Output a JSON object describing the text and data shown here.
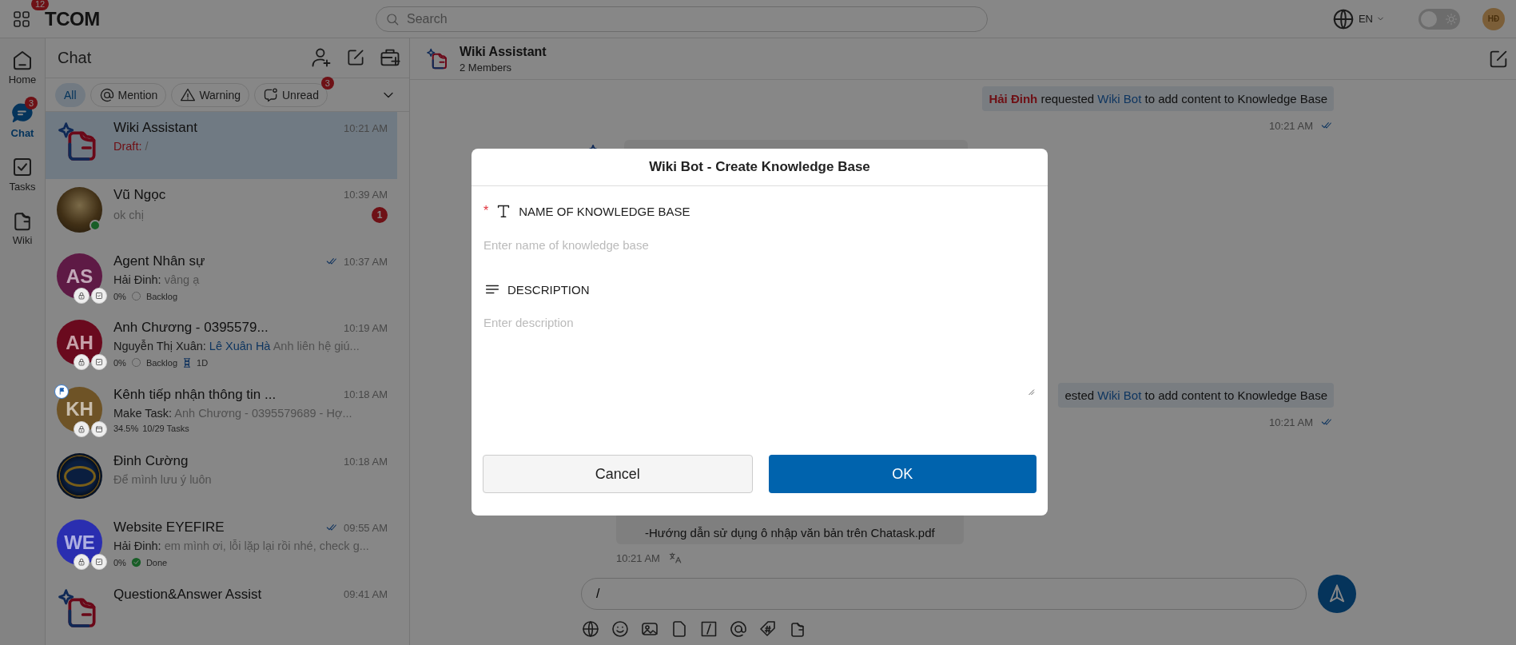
{
  "app": {
    "name": "TCOM",
    "apps_badge": "12"
  },
  "search": {
    "placeholder": "Search"
  },
  "language": {
    "label": "EN"
  },
  "theme_toggle": {
    "on": false
  },
  "user": {
    "initials": "HĐ"
  },
  "nav": [
    {
      "label": "Home",
      "kind": "home",
      "selected": false
    },
    {
      "label": "Chat",
      "kind": "chat",
      "selected": true,
      "badge": "3"
    },
    {
      "label": "Tasks",
      "kind": "tasks",
      "selected": false
    },
    {
      "label": "Wiki",
      "kind": "wiki",
      "selected": false
    }
  ],
  "chat_list": {
    "title": "Chat",
    "filters": [
      {
        "label": "All",
        "kind": "all",
        "selected": true
      },
      {
        "label": "Mention",
        "kind": "mention",
        "selected": false
      },
      {
        "label": "Warning",
        "kind": "warning",
        "selected": false
      },
      {
        "label": "Unread",
        "kind": "unread",
        "selected": false,
        "badge": "3"
      }
    ],
    "items": [
      {
        "kind": "bot",
        "name": "Wiki Assistant",
        "time": "10:21 AM",
        "selected": true,
        "read": false,
        "online": false,
        "flagged": false,
        "preview": {
          "draft": "Draft:",
          "text": "/"
        }
      },
      {
        "kind": "person",
        "name": "Vũ Ngọc",
        "time": "10:39 AM",
        "selected": false,
        "read": false,
        "online": true,
        "flagged": false,
        "unread": "1",
        "preview": {
          "text": "ok chị"
        }
      },
      {
        "kind": "task_group",
        "name": "Agent Nhân sự",
        "time": "10:37 AM",
        "selected": false,
        "read": true,
        "online": false,
        "flagged": false,
        "initials": "AS",
        "color": "#5e1a45",
        "preview": {
          "sender": "Hải Đinh:",
          "text": "vâng ạ"
        },
        "meta": {
          "percent": "0%",
          "status": "Backlog",
          "done": false
        }
      },
      {
        "kind": "task_group",
        "name": "Anh Chương - 0395579...",
        "time": "10:19 AM",
        "selected": false,
        "read": false,
        "online": false,
        "flagged": false,
        "initials": "AH",
        "color": "#6a0a1e",
        "preview": {
          "sender": "Nguyễn Thị Xuân:",
          "mention": "Lê Xuân Hà",
          "text": "Anh liên hệ giú..."
        },
        "meta": {
          "percent": "0%",
          "status": "Backlog",
          "done": false,
          "due": "1D"
        }
      },
      {
        "kind": "project",
        "name": "Kênh tiếp nhận thông tin ...",
        "time": "10:18 AM",
        "selected": false,
        "read": false,
        "online": false,
        "flagged": true,
        "initials": "KH",
        "color": "#6e5326",
        "preview": {
          "sender": "Make Task:",
          "text": "Anh Chương - 0395579689 - Hợ..."
        },
        "meta": {
          "percent": "34.5%",
          "tasks": "10/29 Tasks"
        }
      },
      {
        "kind": "channel",
        "name": "Đinh Cường",
        "time": "10:18 AM",
        "selected": false,
        "read": false,
        "online": false,
        "flagged": false,
        "preview": {
          "text": "Để mình lưu ý luôn"
        }
      },
      {
        "kind": "task_group",
        "name": "Website EYEFIRE",
        "time": "09:55 AM",
        "selected": false,
        "read": true,
        "online": false,
        "flagged": false,
        "initials": "WE",
        "color": "#2a2eb0",
        "preview": {
          "sender": "Hải Đinh:",
          "text": "em mình ơi, lỗi lặp lại rồi nhé, check g..."
        },
        "meta": {
          "percent": "0%",
          "status": "Done",
          "done": true
        }
      },
      {
        "kind": "bot",
        "name": "Question&Answer Assist",
        "time": "09:41 AM",
        "selected": false,
        "read": false,
        "online": false,
        "flagged": false
      }
    ]
  },
  "conversation": {
    "title": "Wiki Assistant",
    "subtitle": "2 Members",
    "messages": [
      {
        "kind": "system",
        "sender": "Hải Đinh",
        "text": "requested",
        "link": "Wiki Bot",
        "rest": "to add content to Knowledge Base",
        "time": "10:21 AM",
        "read": true
      },
      {
        "kind": "bot"
      },
      {
        "kind": "system",
        "text": "ested",
        "link": "Wiki Bot",
        "rest": "to add content to Knowledge Base",
        "time": "10:21 AM",
        "read": true
      },
      {
        "kind": "bot_tail",
        "text": "-Hướng dẫn sử dụng ô nhập văn bản trên Chatask.pdf",
        "time": "10:21 AM",
        "translate": true
      }
    ],
    "composer": {
      "value": "/"
    }
  },
  "dialog": {
    "title": "Wiki Bot - Create Knowledge Base",
    "fields": [
      {
        "kind": "input",
        "label": "NAME OF KNOWLEDGE BASE",
        "required_mark": "*",
        "placeholder": "Enter name of knowledge base"
      },
      {
        "kind": "textarea",
        "label": "DESCRIPTION",
        "placeholder": "Enter description"
      }
    ],
    "buttons": [
      {
        "label": "Cancel",
        "kind": "secondary"
      },
      {
        "label": "OK",
        "kind": "primary"
      }
    ]
  }
}
